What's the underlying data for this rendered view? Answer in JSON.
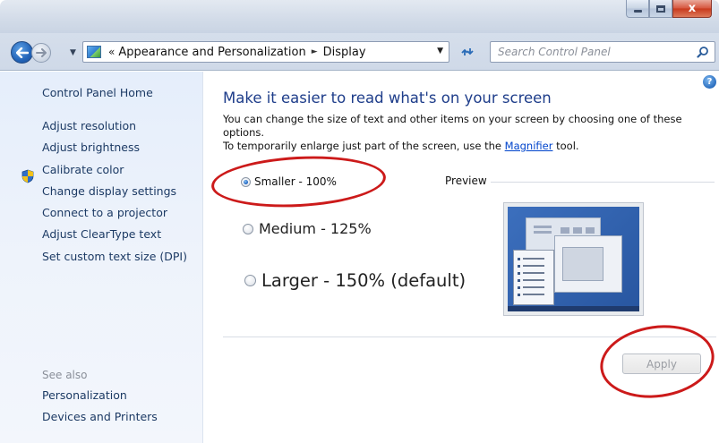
{
  "window": {
    "close_glyph": "x"
  },
  "address": {
    "prefix": "«",
    "crumbs": [
      "Appearance and Personalization",
      "Display"
    ],
    "separator": "►"
  },
  "search": {
    "placeholder": "Search Control Panel"
  },
  "sidebar": {
    "home": "Control Panel Home",
    "items": [
      {
        "label": "Adjust resolution"
      },
      {
        "label": "Adjust brightness"
      },
      {
        "label": "Calibrate color",
        "icon": "shield-icon"
      },
      {
        "label": "Change display settings"
      },
      {
        "label": "Connect to a projector"
      },
      {
        "label": "Adjust ClearType text"
      },
      {
        "label": "Set custom text size (DPI)"
      }
    ],
    "see_also_label": "See also",
    "see_also": [
      {
        "label": "Personalization"
      },
      {
        "label": "Devices and Printers"
      }
    ]
  },
  "main": {
    "title": "Make it easier to read what's on your screen",
    "desc_line1": "You can change the size of text and other items on your screen by choosing one of these options.",
    "desc_line2_pre": "To temporarily enlarge just part of the screen, use the ",
    "desc_link": "Magnifier",
    "desc_line2_post": " tool.",
    "options": [
      {
        "label": "Smaller - 100%",
        "checked": true
      },
      {
        "label": "Medium - 125%",
        "checked": false
      },
      {
        "label": "Larger - 150% (default)",
        "checked": false
      }
    ],
    "preview_label": "Preview",
    "apply_label": "Apply",
    "help_glyph": "?"
  },
  "colors": {
    "title_blue": "#1e3d8a",
    "link_blue": "#0044cc",
    "annotation_red": "#cc1a1a",
    "close_red": "#c8391d"
  }
}
